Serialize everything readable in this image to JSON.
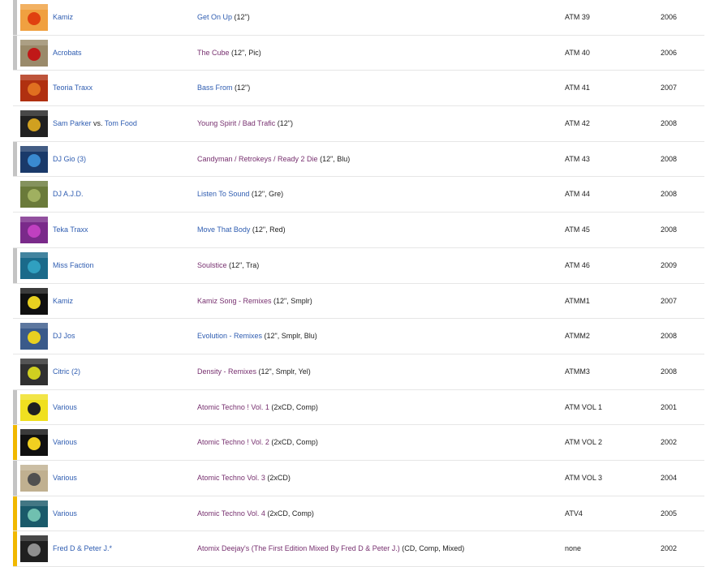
{
  "colors": {
    "link_blue": "#2f5db1",
    "link_visited": "#77306f",
    "marker_gray": "#c4c4c4",
    "marker_yellow": "#f1b800",
    "row_border": "#e6e6e6"
  },
  "rows": [
    {
      "artist": "Kamiz",
      "artist_sep": "",
      "artist2": "",
      "title": "Get On Up",
      "title_color": "blue",
      "format": " (12\")",
      "catno": "ATM 39",
      "year": "2006",
      "marker": "gray",
      "thumb": [
        "#f0a040",
        "#e04010"
      ]
    },
    {
      "artist": "Acrobats",
      "artist_sep": "",
      "artist2": "",
      "title": "The Cube",
      "title_color": "purple",
      "format": " (12\", Pic)",
      "catno": "ATM 40",
      "year": "2006",
      "marker": "gray",
      "thumb": [
        "#9a8a6a",
        "#c01818"
      ]
    },
    {
      "artist": "Teoria Traxx",
      "artist_sep": "",
      "artist2": "",
      "title": "Bass From",
      "title_color": "blue",
      "format": " (12\")",
      "catno": "ATM 41",
      "year": "2007",
      "marker": "none",
      "thumb": [
        "#b03010",
        "#e07020"
      ]
    },
    {
      "artist": "Sam Parker",
      "artist_sep": " vs. ",
      "artist2": "Tom Food",
      "title": "Young Spirit / Bad Trafic",
      "title_color": "purple",
      "format": " (12\")",
      "catno": "ATM 42",
      "year": "2008",
      "marker": "none",
      "thumb": [
        "#202020",
        "#d0a020"
      ]
    },
    {
      "artist": "DJ Gio (3)",
      "artist_sep": "",
      "artist2": "",
      "title": "Candyman / Retrokeys / Ready 2 Die",
      "title_color": "purple",
      "format": " (12\", Blu)",
      "catno": "ATM 43",
      "year": "2008",
      "marker": "gray",
      "thumb": [
        "#1a3a6a",
        "#3a8ad0"
      ]
    },
    {
      "artist": "DJ A.J.D.",
      "artist_sep": "",
      "artist2": "",
      "title": "Listen To Sound",
      "title_color": "blue",
      "format": " (12\", Gre)",
      "catno": "ATM 44",
      "year": "2008",
      "marker": "none",
      "thumb": [
        "#6a7a3a",
        "#a0b060"
      ]
    },
    {
      "artist": "Teka Traxx",
      "artist_sep": "",
      "artist2": "",
      "title": "Move That Body",
      "title_color": "blue",
      "format": " (12\", Red)",
      "catno": "ATM 45",
      "year": "2008",
      "marker": "none",
      "thumb": [
        "#7a2a8a",
        "#c040c0"
      ]
    },
    {
      "artist": "Miss Faction",
      "artist_sep": "",
      "artist2": "",
      "title": "Soulstice",
      "title_color": "purple",
      "format": " (12\", Tra)",
      "catno": "ATM 46",
      "year": "2009",
      "marker": "gray",
      "thumb": [
        "#1a6a8a",
        "#30a0c0"
      ]
    },
    {
      "artist": "Kamiz",
      "artist_sep": "",
      "artist2": "",
      "title": "Kamiz Song - Remixes",
      "title_color": "purple",
      "format": " (12\", Smplr)",
      "catno": "ATMM1",
      "year": "2007",
      "marker": "none",
      "thumb": [
        "#101010",
        "#e8d020"
      ]
    },
    {
      "artist": "DJ Jos",
      "artist_sep": "",
      "artist2": "",
      "title": "Evolution - Remixes",
      "title_color": "blue",
      "format": " (12\", Smplr, Blu)",
      "catno": "ATMM2",
      "year": "2008",
      "marker": "none",
      "thumb": [
        "#3a5a8a",
        "#e8d020"
      ]
    },
    {
      "artist": "Citric (2)",
      "artist_sep": "",
      "artist2": "",
      "title": "Density - Remixes",
      "title_color": "purple",
      "format": " (12\", Smplr, Yel)",
      "catno": "ATMM3",
      "year": "2008",
      "marker": "none",
      "thumb": [
        "#303030",
        "#d0d020"
      ]
    },
    {
      "artist": "Various",
      "artist_sep": "",
      "artist2": "",
      "title": "Atomic Techno ! Vol. 1",
      "title_color": "purple",
      "format": " (2xCD, Comp)",
      "catno": "ATM VOL 1",
      "year": "2001",
      "marker": "gray",
      "thumb": [
        "#f0e020",
        "#202020"
      ]
    },
    {
      "artist": "Various",
      "artist_sep": "",
      "artist2": "",
      "title": "Atomic Techno ! Vol. 2",
      "title_color": "purple",
      "format": " (2xCD, Comp)",
      "catno": "ATM VOL 2",
      "year": "2002",
      "marker": "yellow",
      "thumb": [
        "#101010",
        "#f0d020"
      ]
    },
    {
      "artist": "Various",
      "artist_sep": "",
      "artist2": "",
      "title": "Atomic Techno Vol. 3",
      "title_color": "purple",
      "format": " (2xCD)",
      "catno": "ATM VOL 3",
      "year": "2004",
      "marker": "gray",
      "thumb": [
        "#c0b090",
        "#505050"
      ]
    },
    {
      "artist": "Various",
      "artist_sep": "",
      "artist2": "",
      "title": "Atomic Techno Vol. 4",
      "title_color": "purple",
      "format": " (2xCD, Comp)",
      "catno": "ATV4",
      "year": "2005",
      "marker": "yellow",
      "thumb": [
        "#1a5a6a",
        "#70c0b0"
      ]
    },
    {
      "artist": "Fred D & Peter J.*",
      "artist_sep": "",
      "artist2": "",
      "title": "Atomix Deejay's (The First Edition Mixed By Fred D & Peter J.)",
      "title_color": "purple",
      "format": " (CD, Comp, Mixed)",
      "catno": "none",
      "year": "2002",
      "marker": "yellow",
      "thumb": [
        "#202020",
        "#909090"
      ]
    }
  ]
}
